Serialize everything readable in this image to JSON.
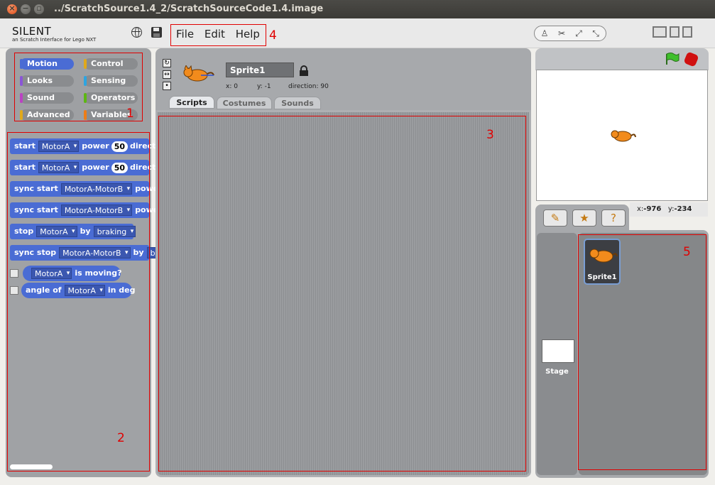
{
  "window": {
    "title": "../ScratchSource1.4_2/ScratchSourceCode1.4.image",
    "close_icon": "×",
    "minimize_icon": "−",
    "maximize_icon": "▫"
  },
  "header": {
    "logo": "SILENT",
    "subtitle": "an Scratch Interface for Lego NXT",
    "menu": [
      "File",
      "Edit",
      "Help"
    ]
  },
  "categories": [
    {
      "label": "Motion",
      "color": "#4a6cd4",
      "active": true
    },
    {
      "label": "Control",
      "color": "#e1a91a"
    },
    {
      "label": "Looks",
      "color": "#8a55d7"
    },
    {
      "label": "Sensing",
      "color": "#2ca5e2"
    },
    {
      "label": "Sound",
      "color": "#bb42c3"
    },
    {
      "label": "Operators",
      "color": "#5cb712"
    },
    {
      "label": "Advanced",
      "color": "#e1a91a"
    },
    {
      "label": "Variables",
      "color": "#ee7d16"
    }
  ],
  "blocks": {
    "b1": {
      "prefix": "start",
      "dd": "MotorA",
      "mid": "power",
      "num": "50",
      "tail": "direct"
    },
    "b2": {
      "prefix": "start",
      "dd": "MotorA",
      "mid": "power",
      "num": "50",
      "tail": "direct"
    },
    "b3": {
      "prefix": "sync start",
      "dd": "MotorA-MotorB",
      "tail": "powe"
    },
    "b4": {
      "prefix": "sync start",
      "dd": "MotorA-MotorB",
      "tail": "powe"
    },
    "b5": {
      "prefix": "stop",
      "dd": "MotorA",
      "mid": "by",
      "dd2": "braking"
    },
    "b6": {
      "prefix": "sync stop",
      "dd": "MotorA-MotorB",
      "mid": "by",
      "tail": "b"
    },
    "b7": {
      "dd": "MotorA",
      "tail": "is moving?"
    },
    "b8": {
      "prefix": "angle of",
      "dd": "MotorA",
      "tail": "in deg"
    }
  },
  "sprite": {
    "name": "Sprite1",
    "x_label": "x:",
    "x": "0",
    "y_label": "y:",
    "y": "-1",
    "dir_label": "direction:",
    "direction": "90"
  },
  "tabs": [
    "Scripts",
    "Costumes",
    "Sounds"
  ],
  "stage": {
    "coords_x_label": "x:",
    "coords_x": "-976",
    "coords_y_label": "y:",
    "coords_y": "-234",
    "stage_label": "Stage"
  },
  "sprite_list": [
    {
      "name": "Sprite1"
    }
  ],
  "annotations": [
    "1",
    "2",
    "3",
    "4",
    "5"
  ],
  "colors": {
    "annotation": "#e00000",
    "motion": "#4a6cd4"
  }
}
